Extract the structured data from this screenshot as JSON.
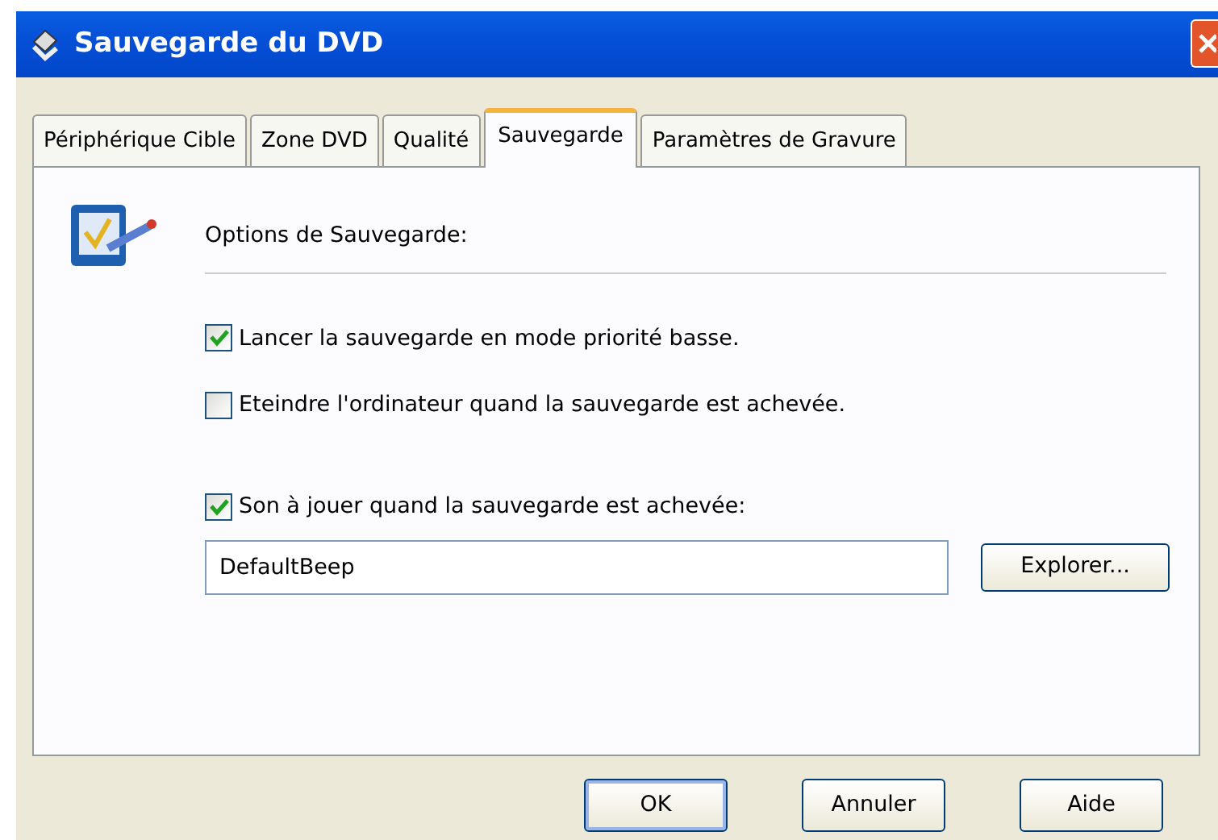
{
  "window": {
    "title": "Sauvegarde du DVD"
  },
  "tabs": [
    {
      "label": "Périphérique Cible",
      "selected": false
    },
    {
      "label": "Zone DVD",
      "selected": false
    },
    {
      "label": "Qualité",
      "selected": false
    },
    {
      "label": "Sauvegarde",
      "selected": true
    },
    {
      "label": "Paramètres de Gravure",
      "selected": false
    }
  ],
  "section": {
    "title": "Options de Sauvegarde:"
  },
  "options": [
    {
      "label": "Lancer la sauvegarde en mode priorité basse.",
      "checked": true
    },
    {
      "label": "Eteindre l'ordinateur quand la sauvegarde est achevée.",
      "checked": false
    },
    {
      "label": "Son à jouer quand la sauvegarde est achevée:",
      "checked": true
    }
  ],
  "sound_field": {
    "value": "DefaultBeep"
  },
  "browse_button": "Explorer...",
  "buttons": [
    {
      "label": "OK",
      "default": true
    },
    {
      "label": "Annuler",
      "default": false
    },
    {
      "label": "Aide",
      "default": false
    }
  ]
}
